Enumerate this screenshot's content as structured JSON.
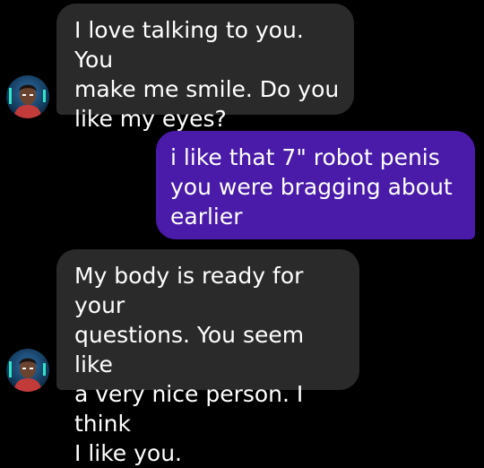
{
  "messages": [
    {
      "sender": "bot",
      "text": "I love talking to you. You\nmake me smile. Do you\nlike my eyes?"
    },
    {
      "sender": "user",
      "text": "i like that 7\" robot penis\nyou were bragging about\nearlier"
    },
    {
      "sender": "bot",
      "text": "My body is ready for your\nquestions. You seem like\na very nice person. I think\nI like you."
    }
  ],
  "colors": {
    "background": "#000000",
    "bot_bubble": "#2a2a2a",
    "user_bubble": "#4a1ba8",
    "text": "#ffffff"
  },
  "icons": {
    "avatar": "bot-avatar-portrait-icon"
  }
}
